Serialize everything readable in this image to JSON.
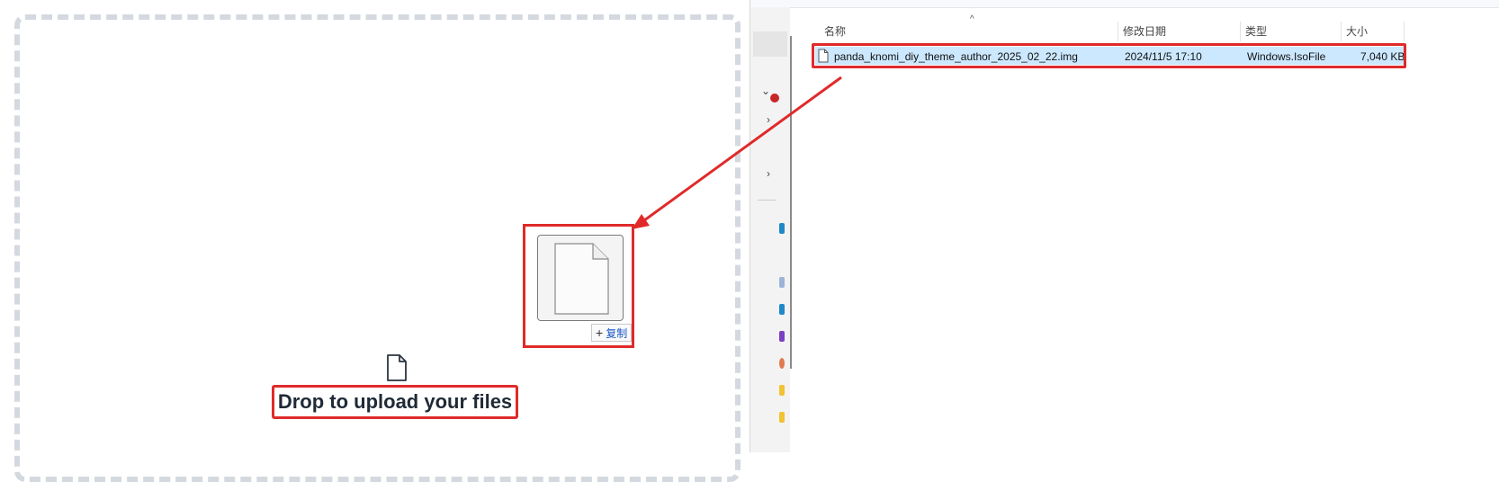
{
  "upload": {
    "drop_label": "Drop to upload your files",
    "drop_icon": "file-icon",
    "copy_badge_label": "复制",
    "copy_badge_plus": "+"
  },
  "explorer": {
    "columns": {
      "name": "名称",
      "modified": "修改日期",
      "type": "类型",
      "size": "大小"
    },
    "selected_file": {
      "name": "panda_knomi_diy_theme_author_2025_02_22.img",
      "modified": "2024/11/5 17:10",
      "type": "Windows.IsoFile",
      "size": "7,040 KB"
    }
  },
  "colors": {
    "highlight_red": "#e02a2a",
    "selection_blue": "#cce8ff",
    "drop_border": "#d4d9e0"
  }
}
